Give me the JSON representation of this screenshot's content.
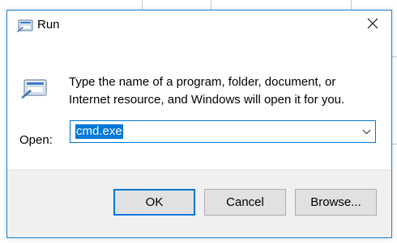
{
  "window": {
    "title": "Run",
    "close_icon": "close-icon",
    "app_icon": "run-icon"
  },
  "message": {
    "line1": "Type the name of a program, folder, document, or",
    "line2": "Internet resource, and Windows will open it for you."
  },
  "open": {
    "label": "Open:",
    "value": "cmd.exe",
    "dropdown_icon": "chevron-down-icon"
  },
  "buttons": {
    "ok": "OK",
    "cancel": "Cancel",
    "browse": "Browse..."
  },
  "colors": {
    "accent": "#0078d7",
    "footer_bg": "#f0f0f0",
    "button_bg": "#e1e1e1"
  }
}
